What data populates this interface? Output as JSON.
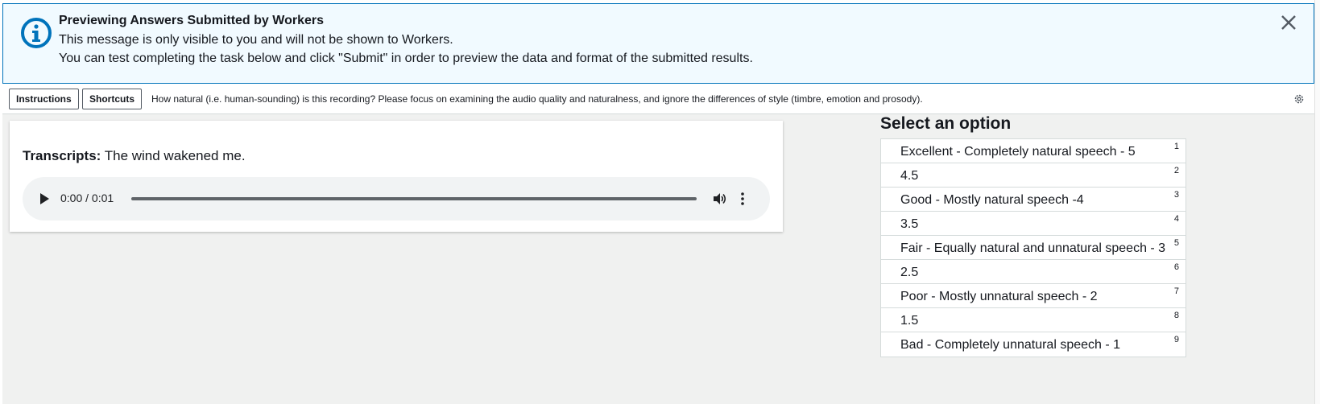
{
  "banner": {
    "title": "Previewing Answers Submitted by Workers",
    "line1": "This message is only visible to you and will not be shown to Workers.",
    "line2": "You can test completing the task below and click \"Submit\" in order to preview the data and format of the submitted results.",
    "info_icon": "info-icon",
    "close_icon": "close-icon",
    "accent_color": "#0073bb",
    "background_color": "#f1faff"
  },
  "toolbar": {
    "instructions_label": "Instructions",
    "shortcuts_label": "Shortcuts",
    "question": "How natural (i.e. human-sounding) is this recording? Please focus on examining the audio quality and naturalness, and ignore the differences of style (timbre, emotion and prosody).",
    "settings_icon": "gear-icon"
  },
  "task": {
    "transcript_label": "Transcripts:",
    "transcript_text": "The wind wakened me.",
    "audio": {
      "time": "0:00 / 0:01",
      "play_icon": "play-icon",
      "volume_icon": "volume-icon",
      "more_icon": "more-vertical-icon"
    }
  },
  "options": {
    "title": "Select an option",
    "items": [
      {
        "label": "Excellent - Completely natural speech - 5",
        "key": "1"
      },
      {
        "label": "4.5",
        "key": "2"
      },
      {
        "label": "Good - Mostly natural speech -4",
        "key": "3"
      },
      {
        "label": "3.5",
        "key": "4"
      },
      {
        "label": "Fair - Equally natural and unnatural speech - 3",
        "key": "5"
      },
      {
        "label": "2.5",
        "key": "6"
      },
      {
        "label": "Poor - Mostly unnatural speech - 2",
        "key": "7"
      },
      {
        "label": "1.5",
        "key": "8"
      },
      {
        "label": "Bad - Completely unnatural speech - 1",
        "key": "9"
      }
    ]
  }
}
